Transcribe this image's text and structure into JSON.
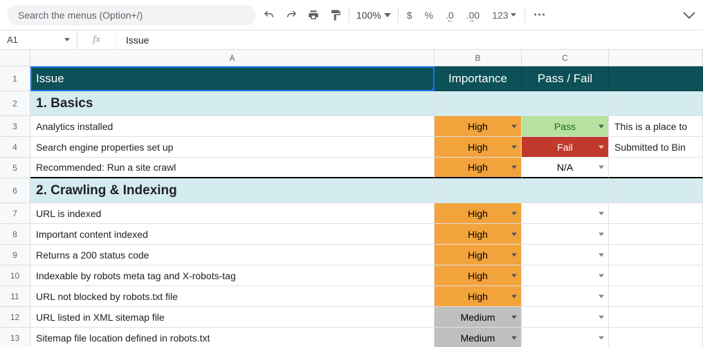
{
  "toolbar": {
    "search_placeholder": "Search the menus (Option+/)",
    "zoom": "100%",
    "currency": "$",
    "percent": "%",
    "dec_dec": ".0",
    "inc_dec": ".00",
    "more_fmt": "123",
    "more": "⋯"
  },
  "name_box": "A1",
  "fx_label": "fx",
  "formula_value": "Issue",
  "col_labels": [
    "A",
    "B",
    "C"
  ],
  "rows": [
    {
      "n": 1,
      "type": "header",
      "a": "Issue",
      "b": "Importance",
      "c": "Pass / Fail",
      "d": ""
    },
    {
      "n": 2,
      "type": "section",
      "a": "1. Basics"
    },
    {
      "n": 3,
      "type": "data",
      "a": "Analytics installed",
      "b": "High",
      "bClass": "imp-high",
      "c": "Pass",
      "cClass": "pass",
      "d": "This is a place to"
    },
    {
      "n": 4,
      "type": "data",
      "a": "Search engine properties set up",
      "b": "High",
      "bClass": "imp-high",
      "c": "Fail",
      "cClass": "fail",
      "d": "Submitted to Bin"
    },
    {
      "n": 5,
      "type": "data",
      "a": "Recommended: Run a site crawl",
      "b": "High",
      "bClass": "imp-high",
      "c": "N/A",
      "cClass": "na",
      "d": "",
      "thick": true
    },
    {
      "n": 6,
      "type": "section",
      "a": "2. Crawling & Indexing"
    },
    {
      "n": 7,
      "type": "data",
      "a": "URL is indexed",
      "b": "High",
      "bClass": "imp-high",
      "c": "",
      "cClass": "",
      "d": ""
    },
    {
      "n": 8,
      "type": "data",
      "a": "Important content indexed",
      "b": "High",
      "bClass": "imp-high",
      "c": "",
      "cClass": "",
      "d": ""
    },
    {
      "n": 9,
      "type": "data",
      "a": "Returns a 200 status code",
      "b": "High",
      "bClass": "imp-high",
      "c": "",
      "cClass": "",
      "d": ""
    },
    {
      "n": 10,
      "type": "data",
      "a": "Indexable by robots meta tag and X-robots-tag",
      "b": "High",
      "bClass": "imp-high",
      "c": "",
      "cClass": "",
      "d": ""
    },
    {
      "n": 11,
      "type": "data",
      "a": "URL not blocked by robots.txt file",
      "b": "High",
      "bClass": "imp-high",
      "c": "",
      "cClass": "",
      "d": ""
    },
    {
      "n": 12,
      "type": "data",
      "a": "URL listed in XML sitemap file",
      "b": "Medium",
      "bClass": "imp-med",
      "c": "",
      "cClass": "",
      "d": ""
    },
    {
      "n": 13,
      "type": "data",
      "a": "Sitemap file location defined in robots.txt",
      "b": "Medium",
      "bClass": "imp-med",
      "c": "",
      "cClass": "",
      "d": ""
    }
  ]
}
